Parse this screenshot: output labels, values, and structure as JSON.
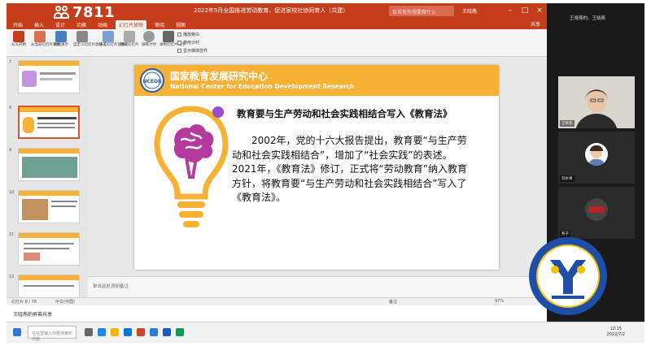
{
  "window": {
    "title": "2022年5月全国推进劳动教育、促进家校社协同育人（共建）",
    "search_placeholder": "告诉我你想要做什么",
    "user_name": "王晓燕",
    "share_label": "共享"
  },
  "meeting": {
    "participant_count": "7811"
  },
  "tabs": [
    "开始",
    "插入",
    "设计",
    "切换",
    "动画",
    "幻灯片放映",
    "审阅",
    "视图"
  ],
  "active_tab_index": 5,
  "ribbon": {
    "buttons": [
      "从头开始",
      "从当前幻灯片开始",
      "联机演示",
      "自定义幻灯片放映",
      "设置幻灯片放映",
      "隐藏幻灯片",
      "排练计时",
      "录制幻灯片演示"
    ],
    "checkboxes": [
      "播放旁白",
      "使用计时",
      "显示媒体控件"
    ]
  },
  "thumbnails": {
    "numbers": [
      "7",
      "8",
      "9",
      "10",
      "11",
      "12"
    ],
    "selected_index": 1
  },
  "slide": {
    "org_name_cn": "国家教育发展研究中心",
    "org_name_en": "National Center for Education Development Research",
    "logo_text": "NCEDR",
    "title": "教育要与生产劳动和社会实践相结合写入《教育法》",
    "body": "2002年，党的十六大报告提出，教育要“与生产劳动和社会实践相结合”，增加了“社会实践”的表述。2021年，《教育法》修订，正式将“劳动教育”纳入教育方针，将教育要“与生产劳动和社会实践相结合”写入了《教育法》。"
  },
  "notes_placeholder": "单击此处添加备注",
  "status": {
    "slide_counter": "幻灯片 8 / 78",
    "language": "中文(中国)",
    "notes_label": "备注",
    "zoom": "97%"
  },
  "screen_share_text": "王晓燕的屏幕共享",
  "taskbar": {
    "search_placeholder": "在这里输入你要搜索的内容",
    "time": "12:15",
    "date": "2022/7/2"
  },
  "sidebar": {
    "title": "王晓燕的、王晓燕",
    "participants": [
      {
        "name": "王晓燕"
      },
      {
        "name": "刘水青"
      },
      {
        "name": "燕子"
      }
    ]
  },
  "emblem": {
    "text": "Camp Education Industry Conference"
  },
  "colors": {
    "ppt_red": "#c43e1c",
    "banner_orange": "#f7b135",
    "purple": "#9b4dcb"
  }
}
